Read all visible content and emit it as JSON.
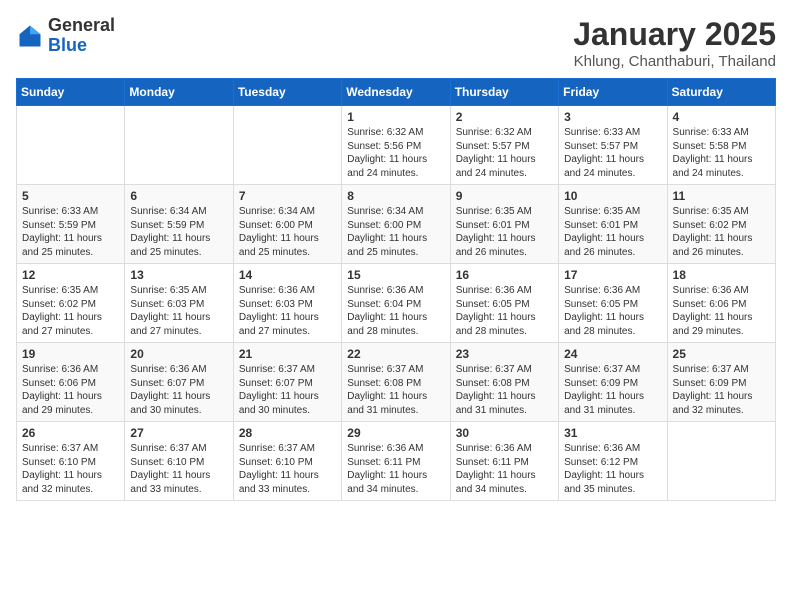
{
  "header": {
    "logo_general": "General",
    "logo_blue": "Blue",
    "month_title": "January 2025",
    "location": "Khlung, Chanthaburi, Thailand"
  },
  "days_of_week": [
    "Sunday",
    "Monday",
    "Tuesday",
    "Wednesday",
    "Thursday",
    "Friday",
    "Saturday"
  ],
  "weeks": [
    [
      {
        "day": "",
        "info": ""
      },
      {
        "day": "",
        "info": ""
      },
      {
        "day": "",
        "info": ""
      },
      {
        "day": "1",
        "info": "Sunrise: 6:32 AM\nSunset: 5:56 PM\nDaylight: 11 hours\nand 24 minutes."
      },
      {
        "day": "2",
        "info": "Sunrise: 6:32 AM\nSunset: 5:57 PM\nDaylight: 11 hours\nand 24 minutes."
      },
      {
        "day": "3",
        "info": "Sunrise: 6:33 AM\nSunset: 5:57 PM\nDaylight: 11 hours\nand 24 minutes."
      },
      {
        "day": "4",
        "info": "Sunrise: 6:33 AM\nSunset: 5:58 PM\nDaylight: 11 hours\nand 24 minutes."
      }
    ],
    [
      {
        "day": "5",
        "info": "Sunrise: 6:33 AM\nSunset: 5:59 PM\nDaylight: 11 hours\nand 25 minutes."
      },
      {
        "day": "6",
        "info": "Sunrise: 6:34 AM\nSunset: 5:59 PM\nDaylight: 11 hours\nand 25 minutes."
      },
      {
        "day": "7",
        "info": "Sunrise: 6:34 AM\nSunset: 6:00 PM\nDaylight: 11 hours\nand 25 minutes."
      },
      {
        "day": "8",
        "info": "Sunrise: 6:34 AM\nSunset: 6:00 PM\nDaylight: 11 hours\nand 25 minutes."
      },
      {
        "day": "9",
        "info": "Sunrise: 6:35 AM\nSunset: 6:01 PM\nDaylight: 11 hours\nand 26 minutes."
      },
      {
        "day": "10",
        "info": "Sunrise: 6:35 AM\nSunset: 6:01 PM\nDaylight: 11 hours\nand 26 minutes."
      },
      {
        "day": "11",
        "info": "Sunrise: 6:35 AM\nSunset: 6:02 PM\nDaylight: 11 hours\nand 26 minutes."
      }
    ],
    [
      {
        "day": "12",
        "info": "Sunrise: 6:35 AM\nSunset: 6:02 PM\nDaylight: 11 hours\nand 27 minutes."
      },
      {
        "day": "13",
        "info": "Sunrise: 6:35 AM\nSunset: 6:03 PM\nDaylight: 11 hours\nand 27 minutes."
      },
      {
        "day": "14",
        "info": "Sunrise: 6:36 AM\nSunset: 6:03 PM\nDaylight: 11 hours\nand 27 minutes."
      },
      {
        "day": "15",
        "info": "Sunrise: 6:36 AM\nSunset: 6:04 PM\nDaylight: 11 hours\nand 28 minutes."
      },
      {
        "day": "16",
        "info": "Sunrise: 6:36 AM\nSunset: 6:05 PM\nDaylight: 11 hours\nand 28 minutes."
      },
      {
        "day": "17",
        "info": "Sunrise: 6:36 AM\nSunset: 6:05 PM\nDaylight: 11 hours\nand 28 minutes."
      },
      {
        "day": "18",
        "info": "Sunrise: 6:36 AM\nSunset: 6:06 PM\nDaylight: 11 hours\nand 29 minutes."
      }
    ],
    [
      {
        "day": "19",
        "info": "Sunrise: 6:36 AM\nSunset: 6:06 PM\nDaylight: 11 hours\nand 29 minutes."
      },
      {
        "day": "20",
        "info": "Sunrise: 6:36 AM\nSunset: 6:07 PM\nDaylight: 11 hours\nand 30 minutes."
      },
      {
        "day": "21",
        "info": "Sunrise: 6:37 AM\nSunset: 6:07 PM\nDaylight: 11 hours\nand 30 minutes."
      },
      {
        "day": "22",
        "info": "Sunrise: 6:37 AM\nSunset: 6:08 PM\nDaylight: 11 hours\nand 31 minutes."
      },
      {
        "day": "23",
        "info": "Sunrise: 6:37 AM\nSunset: 6:08 PM\nDaylight: 11 hours\nand 31 minutes."
      },
      {
        "day": "24",
        "info": "Sunrise: 6:37 AM\nSunset: 6:09 PM\nDaylight: 11 hours\nand 31 minutes."
      },
      {
        "day": "25",
        "info": "Sunrise: 6:37 AM\nSunset: 6:09 PM\nDaylight: 11 hours\nand 32 minutes."
      }
    ],
    [
      {
        "day": "26",
        "info": "Sunrise: 6:37 AM\nSunset: 6:10 PM\nDaylight: 11 hours\nand 32 minutes."
      },
      {
        "day": "27",
        "info": "Sunrise: 6:37 AM\nSunset: 6:10 PM\nDaylight: 11 hours\nand 33 minutes."
      },
      {
        "day": "28",
        "info": "Sunrise: 6:37 AM\nSunset: 6:10 PM\nDaylight: 11 hours\nand 33 minutes."
      },
      {
        "day": "29",
        "info": "Sunrise: 6:36 AM\nSunset: 6:11 PM\nDaylight: 11 hours\nand 34 minutes."
      },
      {
        "day": "30",
        "info": "Sunrise: 6:36 AM\nSunset: 6:11 PM\nDaylight: 11 hours\nand 34 minutes."
      },
      {
        "day": "31",
        "info": "Sunrise: 6:36 AM\nSunset: 6:12 PM\nDaylight: 11 hours\nand 35 minutes."
      },
      {
        "day": "",
        "info": ""
      }
    ]
  ]
}
